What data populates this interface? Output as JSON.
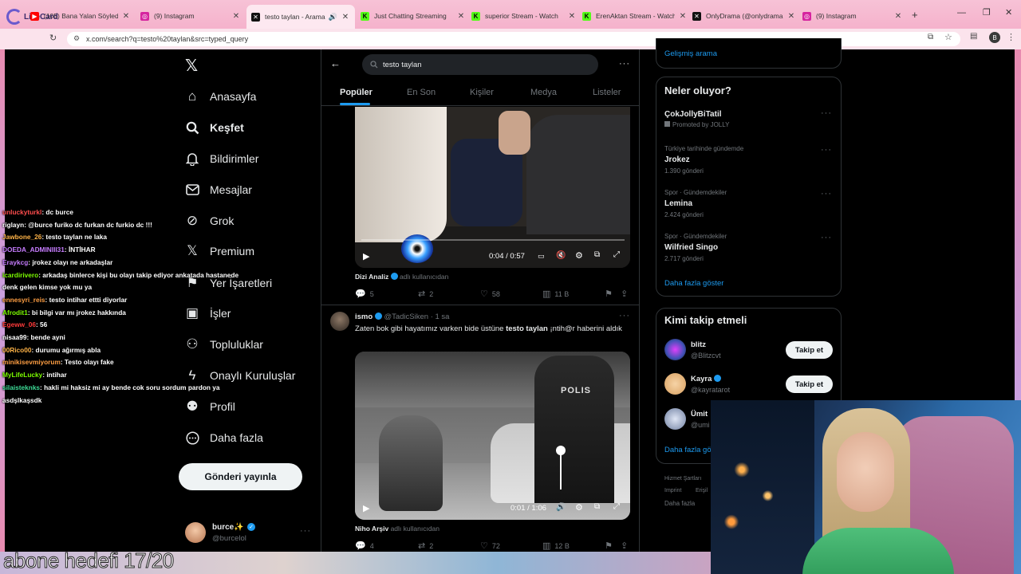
{
  "browser": {
    "tabs": [
      {
        "title": "(105) Bana Yalan Söyledin",
        "fav_color": "#ff0000"
      },
      {
        "title": "(9) Instagram",
        "fav_color": "#d6249f"
      },
      {
        "title": "testo taylan - Arama",
        "fav_color": "#111111"
      },
      {
        "title": "Just Chatting Streaming",
        "fav_color": "#53fc18"
      },
      {
        "title": "superior Stream - Watch",
        "fav_color": "#53fc18"
      },
      {
        "title": "ErenAktan Stream - Watch",
        "fav_color": "#53fc18"
      },
      {
        "title": "OnlyDrama (@onlydrama",
        "fav_color": "#111111"
      },
      {
        "title": "(9) Instagram",
        "fav_color": "#d6249f"
      }
    ],
    "url": "x.com/search?q=testo%20taylan&src=typed_query",
    "profile_initial": "B",
    "overlay_logo": "LikeCard"
  },
  "sidebar": {
    "items": [
      {
        "label": "Anasayfa",
        "icon": "home-icon",
        "glyph": "⌂"
      },
      {
        "label": "Keşfet",
        "icon": "search-icon",
        "glyph": "⚲"
      },
      {
        "label": "Bildirimler",
        "icon": "bell-icon",
        "glyph": "🔔"
      },
      {
        "label": "Mesajlar",
        "icon": "mail-icon",
        "glyph": "✉"
      },
      {
        "label": "Grok",
        "icon": "grok-icon",
        "glyph": "⊘"
      },
      {
        "label": "Premium",
        "icon": "x-logo-icon",
        "glyph": "𝕏"
      },
      {
        "label": "Yer İşaretleri",
        "icon": "bookmark-icon",
        "glyph": "⚑"
      },
      {
        "label": "İşler",
        "icon": "briefcase-icon",
        "glyph": "▣"
      },
      {
        "label": "Topluluklar",
        "icon": "people-icon",
        "glyph": "⚇"
      },
      {
        "label": "Onaylı Kuruluşlar",
        "icon": "lightning-icon",
        "glyph": "ϟ"
      },
      {
        "label": "Profil",
        "icon": "person-icon",
        "glyph": "⚉"
      },
      {
        "label": "Daha fazla",
        "icon": "more-circle-icon",
        "glyph": "⋯"
      }
    ],
    "post_button": "Gönderi yayınla",
    "account": {
      "name": "burce✨",
      "handle": "@burcelol"
    }
  },
  "search": {
    "query": "testo taylan",
    "tabs": [
      "Popüler",
      "En Son",
      "Kişiler",
      "Medya",
      "Listeler"
    ]
  },
  "tweet1": {
    "video_time": "0:04 / 0:57",
    "author": "Dizi Analiz",
    "suffix": "adlı kullanıcıdan",
    "replies": "5",
    "retweets": "2",
    "likes": "58",
    "views": "11 B"
  },
  "tweet2": {
    "name": "ismo",
    "handle": "@TadicSiken · 1 sa",
    "text_before": "Zaten bok gibi hayatımız varken bide üstüne ",
    "text_bold": "testo taylan",
    "text_after": " ¡ntih@r haberini aldık",
    "video_time": "0:01 / 1:06",
    "video_sign": "POLIS",
    "author": "Niho Arşiv",
    "suffix": "adlı kullanıcıdan",
    "replies": "4",
    "retweets": "2",
    "likes": "72",
    "views": "12 B"
  },
  "right": {
    "advanced_search": "Gelişmiş arama",
    "trends_title": "Neler oluyor?",
    "trends": [
      {
        "meta": "",
        "name": "ÇokJollyBiTatil",
        "count": "Promoted by JOLLY"
      },
      {
        "meta": "Türkiye tarihinde gündemde",
        "name": "Jrokez",
        "count": "1.390 gönderi"
      },
      {
        "meta": "Spor · Gündemdekiler",
        "name": "Lemina",
        "count": "2.424 gönderi"
      },
      {
        "meta": "Spor · Gündemdekiler",
        "name": "Wilfried Singo",
        "count": "2.717 gönderi"
      }
    ],
    "show_more": "Daha fazla göster",
    "follow_title": "Kimi takip etmeli",
    "follow": [
      {
        "name": "blitz",
        "handle": "@Blitzcvt",
        "button": "Takip et"
      },
      {
        "name": "Kayra",
        "handle": "@kayratarot",
        "button": "Takip et"
      },
      {
        "name": "Ümit",
        "handle": "@umi"
      }
    ],
    "follow_more": "Daha fazla gö",
    "footer": [
      "Hizmet Şartları",
      "Imprint",
      "Erişil",
      "Daha fazla"
    ]
  },
  "chat": [
    {
      "user": "unluckyturkl",
      "msg": ": dc burce",
      "color": "#ff4d4d"
    },
    {
      "user": "riglayn",
      "msg": ": @burce furiko dc furkan dc furkio dc !!!",
      "color": "#ffffff"
    },
    {
      "user": "Jawbone_26",
      "msg": ": testo taylan ne laka",
      "color": "#ffb347"
    },
    {
      "user": "DOEDA_ADMINIII31",
      "msg": ": İNTİHAR",
      "color": "#c77dff"
    },
    {
      "user": "Eraykcg",
      "msg": ": jrokez olayı ne arkadaşlar",
      "color": "#c77dff"
    },
    {
      "user": "icardirivero",
      "msg": ": arkadaş binlerce kişi bu olayı takip ediyor ankatada hastanede",
      "color": "#7CFC00"
    },
    {
      "user": "",
      "msg": "denk gelen kimse yok mu ya",
      "color": "#ffffff"
    },
    {
      "user": "ennesyri_reis",
      "msg": ": testo intihar ettti diyorlar",
      "color": "#ff9f43"
    },
    {
      "user": "Afrodit1",
      "msg": ": bi bilgi var mı jrokez hakkında",
      "color": "#7CFC00"
    },
    {
      "user": "Egeww_06",
      "msg": ": 56",
      "color": "#ff3b3b"
    },
    {
      "user": "nisaa99",
      "msg": ": bende ayni",
      "color": "#ffffff"
    },
    {
      "user": "00Rico00",
      "msg": ": durumu ağırmış abla",
      "color": "#ffb347"
    },
    {
      "user": "minikisevmiyorum",
      "msg": ": Testo olayı fake",
      "color": "#ff9f43"
    },
    {
      "user": "MyLifeLucky",
      "msg": ": intihar",
      "color": "#7CFC00"
    },
    {
      "user": "silaisteknks",
      "msg": ": hakli mi haksiz mi ay bende cok soru sordum pardon ya",
      "color": "#3ddc97"
    },
    {
      "user": "",
      "msg": "asdşlkaşsdk",
      "color": "#ffffff"
    }
  ],
  "goal_text": "abone hedefi 17/20"
}
